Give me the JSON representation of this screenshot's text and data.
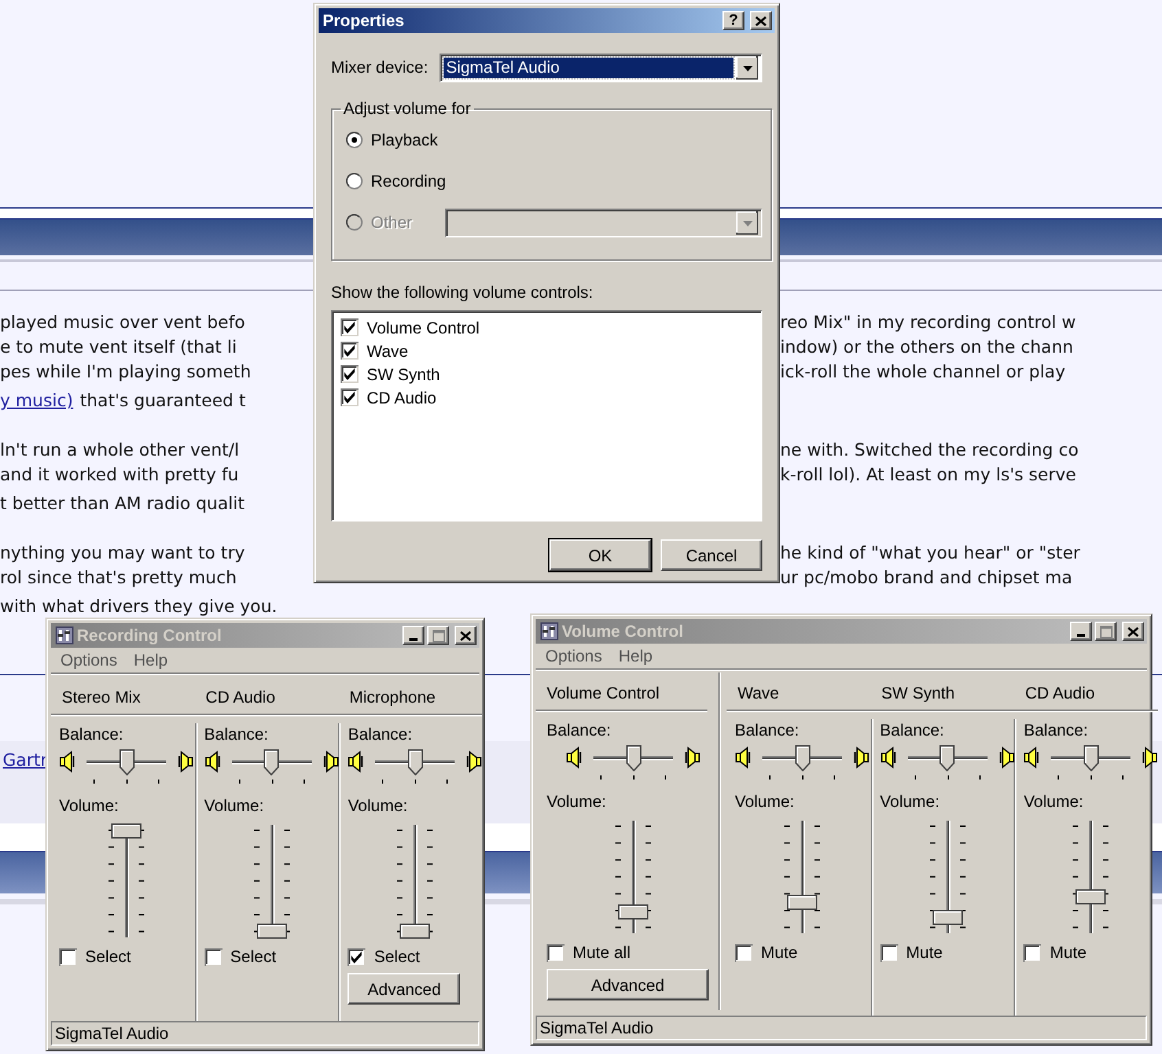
{
  "web_page": {
    "paragraphs": [
      {
        "lines": [
          {
            "start": "played music over vent befo",
            "end": "reo Mix\" in my recording control w"
          },
          {
            "start": "e to mute vent itself (that li",
            "end": "indow) or the others on the chann"
          },
          {
            "start": "pes while I'm playing someth",
            "end": "ick-roll the whole channel or play"
          },
          {
            "link": "y music)",
            "start": "that's guaranteed t"
          }
        ]
      },
      {
        "lines": [
          {
            "start": "ln't run a whole other vent/l",
            "end": "ne with. Switched the recording co"
          },
          {
            "start": "and it worked with pretty fu",
            "end": "k-roll lol). At least on my ls's serve"
          },
          {
            "start": "t better than AM radio qualit"
          }
        ]
      },
      {
        "lines": [
          {
            "start": "nything you may want to try",
            "end": "he kind of \"what you hear\" or \"ster"
          },
          {
            "start": "rol since that's pretty much",
            "end": "ur pc/mobo brand and chipset ma"
          },
          {
            "start": "with what drivers they give you."
          }
        ]
      }
    ],
    "link_row": {
      "link": "Gartr"
    }
  },
  "properties_dialog": {
    "title": "Properties",
    "active": true,
    "help_button": "?",
    "mixer_device": {
      "label": "Mixer device:",
      "value": "SigmaTel Audio"
    },
    "adjust_group": {
      "label": "Adjust volume for",
      "options": [
        {
          "label": "Playback",
          "selected": true,
          "disabled": false,
          "device_list": false
        },
        {
          "label": "Recording",
          "selected": false,
          "disabled": false,
          "device_list": false
        },
        {
          "label": "Other",
          "selected": false,
          "disabled": true,
          "device_list": true
        }
      ]
    },
    "controls_label": "Show the following volume controls:",
    "controls": [
      {
        "label": "Volume Control",
        "checked": true
      },
      {
        "label": "Wave",
        "checked": true
      },
      {
        "label": "SW Synth",
        "checked": true
      },
      {
        "label": "CD Audio",
        "checked": true
      }
    ],
    "buttons": [
      {
        "label": "OK",
        "default": true
      },
      {
        "label": "Cancel",
        "default": false
      }
    ]
  },
  "recording_control": {
    "title": "Recording Control",
    "active": false,
    "menu": [
      "Options",
      "Help"
    ],
    "channels": [
      {
        "name": "Stereo Mix",
        "balance": {
          "label": "Balance:",
          "level": 0.5
        },
        "volume": {
          "label": "Volume:",
          "level": 1
        },
        "option": {
          "label": "Select",
          "checked": false
        }
      },
      {
        "name": "CD Audio",
        "balance": {
          "label": "Balance:",
          "level": 0.5
        },
        "volume": {
          "label": "Volume:",
          "level": 0
        },
        "option": {
          "label": "Select",
          "checked": false
        }
      },
      {
        "name": "Microphone",
        "balance": {
          "label": "Balance:",
          "level": 0.5
        },
        "volume": {
          "label": "Volume:",
          "level": 0
        },
        "option": {
          "label": "Select",
          "checked": true
        },
        "advanced_button": "Advanced"
      }
    ],
    "status": "SigmaTel Audio"
  },
  "volume_control": {
    "title": "Volume Control",
    "active": false,
    "menu": [
      "Options",
      "Help"
    ],
    "master": {
      "name": "Volume Control",
      "balance": {
        "label": "Balance:",
        "level": 0.5
      },
      "volume": {
        "label": "Volume:",
        "level": 0.15
      },
      "option": {
        "label": "Mute all",
        "checked": false
      },
      "advanced_button": "Advanced"
    },
    "channels": [
      {
        "name": "Wave",
        "balance": {
          "label": "Balance:",
          "level": 0.5
        },
        "volume": {
          "label": "Volume:",
          "level": 0.25
        },
        "option": {
          "label": "Mute",
          "checked": false
        }
      },
      {
        "name": "SW Synth",
        "balance": {
          "label": "Balance:",
          "level": 0.5
        },
        "volume": {
          "label": "Volume:",
          "level": 0.1
        },
        "option": {
          "label": "Mute",
          "checked": false
        }
      },
      {
        "name": "CD Audio",
        "balance": {
          "label": "Balance:",
          "level": 0.5
        },
        "volume": {
          "label": "Volume:",
          "level": 0.3
        },
        "option": {
          "label": "Mute",
          "checked": false
        }
      }
    ],
    "status": "SigmaTel Audio"
  }
}
